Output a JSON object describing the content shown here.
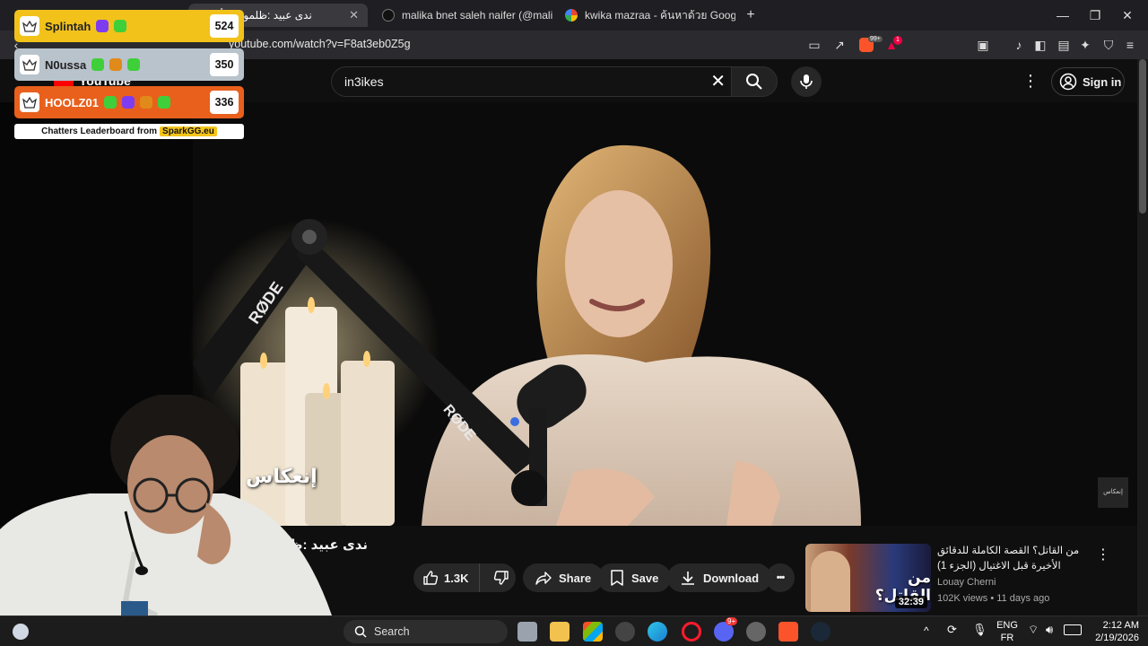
{
  "browser": {
    "tabs": [
      {
        "title": "ندى عبيد :ظلموني وأصبت"
      },
      {
        "title": "malika bnet saleh naifer (@malikabn"
      },
      {
        "title": "kwika mazraa - ค้นหาด้วย Google"
      }
    ],
    "new_tab": "+",
    "window_controls": {
      "minimize": "—",
      "maximize": "❐",
      "close": "✕"
    },
    "url": "youtube.com/watch?v=F8at3eb0Z5g",
    "brave_badge": "99+",
    "alert_badge": "1"
  },
  "youtube": {
    "logo_text": "YouTube",
    "search_value": "in3ikes",
    "sign_in": "Sign in",
    "video": {
      "title": "ندى عبيد :ظلموني وأصبت",
      "subtitle_overlay": "إنعكاس",
      "watermark": "إنعكاس",
      "actions": {
        "like_count": "1.3K",
        "share": "Share",
        "save": "Save",
        "download": "Download",
        "more": "•••"
      }
    },
    "recommended": [
      {
        "title": "من القاتل؟ القصة الكاملة للدقائق الأخيرة قبل الاغتيال (الجزء 1)",
        "thumbnail_text": "من القاتل؟",
        "duration": "32:39",
        "channel": "Louay Cherni",
        "views": "102K views",
        "age": "11 days ago",
        "meta_sep": " • "
      }
    ]
  },
  "leaderboard": {
    "rows": [
      {
        "name": "Splintah",
        "score": "524",
        "bg": "#f2c21a"
      },
      {
        "name": "N0ussa",
        "score": "350",
        "bg": "#b9c3cc"
      },
      {
        "name": "HOOLZ01",
        "score": "336",
        "bg": "#e8601c"
      }
    ],
    "footer_prefix": "Chatters Leaderboard from",
    "footer_brand": "SparkGG.eu"
  },
  "taskbar": {
    "search_label": "Search",
    "lang_top": "ENG",
    "lang_bottom": "FR",
    "time": "2:12 AM",
    "date": "2/19/2026",
    "discord_badge": "9+"
  },
  "colors": {
    "accent_red": "#ff0000",
    "brave_orange": "#fb542b",
    "yt_bg": "#0f0f0f"
  }
}
